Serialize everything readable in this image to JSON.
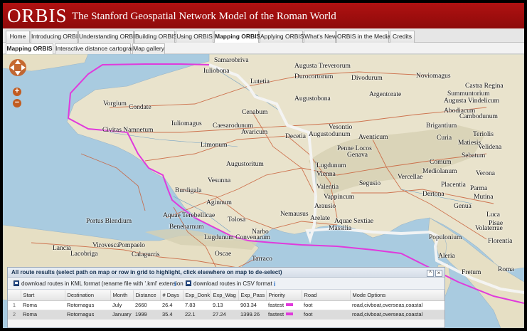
{
  "header": {
    "logo": "ORBIS",
    "tagline": "The Stanford Geospatial Network Model of the Roman World"
  },
  "main_nav": [
    {
      "label": "Home"
    },
    {
      "label": "Introducing ORBIS"
    },
    {
      "label": "Understanding ORBIS"
    },
    {
      "label": "Building ORBIS"
    },
    {
      "label": "Using ORBIS"
    },
    {
      "label": "Mapping ORBIS",
      "active": true
    },
    {
      "label": "Applying ORBIS"
    },
    {
      "label": "What's New"
    },
    {
      "label": "ORBIS in the Media"
    },
    {
      "label": "Credits"
    }
  ],
  "sub_nav": [
    {
      "label": "Mapping ORBIS",
      "active": true
    },
    {
      "label": "Interactive distance cartogram"
    },
    {
      "label": "Map gallery"
    }
  ],
  "map": {
    "places": [
      "Samarobriva",
      "Augusta Treverorum",
      "Iuliobona",
      "Noviomagus",
      "Lutetia",
      "Durocortorum",
      "Divodurum",
      "Augustobona",
      "Castra Regina",
      "Argentorate",
      "Summuntorium",
      "Vorgium",
      "Augusta Vindelicum",
      "Condate",
      "Abodiacum",
      "Cambodunum",
      "Cenabum",
      "Iuliomagus",
      "Caesarodunum",
      "Vesontio",
      "Brigantium",
      "Decetia",
      "Augustodunum",
      "Aventicum",
      "Curia",
      "Teriolis",
      "Civitas Namnetum",
      "Avaricum",
      "Velidena",
      "Limonum",
      "Penne Locos",
      "Matiesis",
      "Genava",
      "Sebatum",
      "Comum",
      "Lugdunum",
      "Augustoritum",
      "Vienna",
      "Segusio",
      "Vercellae",
      "Verona",
      "Mediolanum",
      "Vesunna",
      "Burdigala",
      "Valentia",
      "Placentia",
      "Parma",
      "Aginnum",
      "Vappincum",
      "Mutina",
      "Dertona",
      "Genua",
      "Arausio",
      "Luca",
      "Nemausus",
      "Arelate",
      "Aquae Sextiae",
      "Pisae",
      "Tolosa",
      "Massilia",
      "Portus Blendium",
      "Aquae Terebellicae",
      "Beneharnum",
      "Narbo",
      "Lugdunum Convenarum",
      "Populonium",
      "Pompaelo",
      "Lancia",
      "Lacobriga",
      "Virovesca",
      "Calagurris",
      "Oscae",
      "Tarraco",
      "Roma",
      "Fretum",
      "Volaterrae",
      "Florentia",
      "Aleria"
    ]
  },
  "results": {
    "title": "All route results (select path on map or row in grid to highlight, click elsewhere on map to de-select)",
    "download_kml": "download routes in KML format (rename file with '.kml' extension",
    "download_csv": "download routes in CSV format",
    "columns": [
      "Start",
      "Destination",
      "Month",
      "Distance",
      "# Days",
      "Exp_Donk",
      "Exp_Wag",
      "Exp_Pass",
      "Priority",
      "Road",
      "Mode Options"
    ],
    "rows": [
      {
        "num": "1",
        "cells": [
          "Roma",
          "Rotomagus",
          "July",
          "2660",
          "26.4",
          "7.83",
          "9.13",
          "903.34",
          "fastest",
          "foot",
          "road,civboat,overseas,coastal"
        ]
      },
      {
        "num": "2",
        "cells": [
          "Roma",
          "Rotomagus",
          "January",
          "1999",
          "35.4",
          "22.1",
          "27.24",
          "1399.26",
          "fastest",
          "foot",
          "road,civboat,overseas,coastal"
        ]
      }
    ],
    "route_color": "#e03adc"
  },
  "colors": {
    "header_red": "#a30f0f",
    "sea": "#a9cbe0",
    "land": "#e9e3cc"
  }
}
